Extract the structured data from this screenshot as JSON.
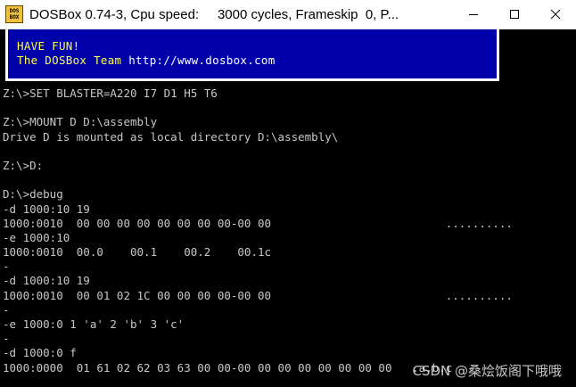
{
  "window": {
    "title": "DOSBox 0.74-3, Cpu speed:     3000 cycles, Frameskip  0, P...",
    "icon_text": [
      "DOS",
      "BOX"
    ],
    "controls": [
      "minimize-icon",
      "maximize-icon",
      "close-icon"
    ]
  },
  "banner": {
    "line1": "HAVE FUN!",
    "line2_prefix": "The DOSBox Team ",
    "line2_url": "http://www.dosbox.com"
  },
  "console": {
    "lines": [
      "Z:\\>SET BLASTER=A220 I7 D1 H5 T6",
      "",
      "Z:\\>MOUNT D D:\\assembly",
      "Drive D is mounted as local directory D:\\assembly\\",
      "",
      "Z:\\>D:",
      "",
      "D:\\>debug",
      "-d 1000:10 19",
      "1000:0010  00 00 00 00 00 00 00 00-00 00                          ..........",
      "-e 1000:10",
      "1000:0010  00.0    00.1    00.2    00.1c",
      "-",
      "-d 1000:10 19",
      "1000:0010  00 01 02 1C 00 00 00 00-00 00                          ..........",
      "-",
      "-e 1000:0 1 'a' 2 'b' 3 'c'",
      "-",
      "-d 1000:0 f",
      "1000:0000  01 61 02 62 03 63 00 00-00 00 00 00 00 00 00 00   .a.b.c"
    ]
  },
  "watermark": "CSDN @桑烩饭阁下哦哦"
}
